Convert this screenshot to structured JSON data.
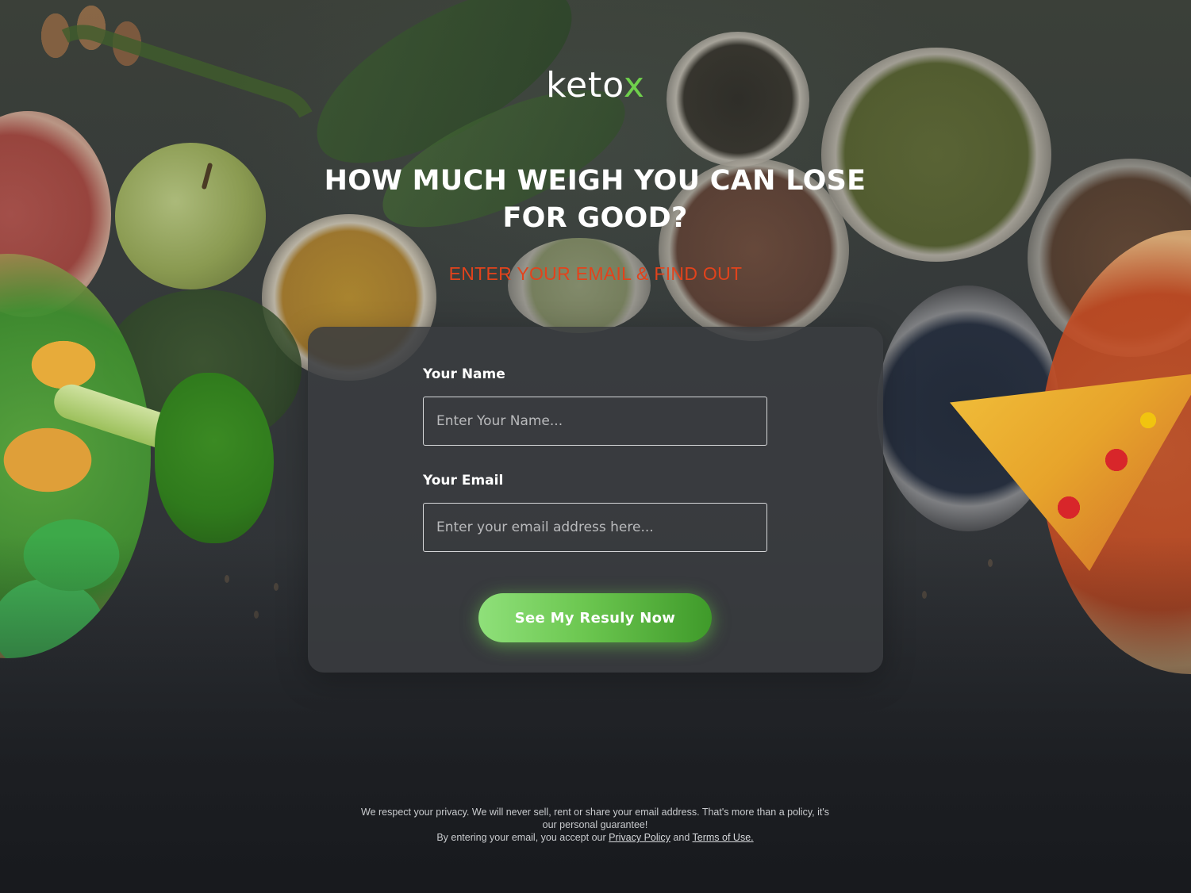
{
  "brand": {
    "logo_main": "keto",
    "logo_accent": "x",
    "accent_color": "#6fd04c"
  },
  "hero": {
    "headline": "HOW MUCH WEIGH YOU CAN LOSE FOR GOOD?",
    "subheadline": "ENTER YOUR EMAIL & FIND OUT",
    "subheadline_color": "#e2431c"
  },
  "form": {
    "name_label": "Your Name",
    "name_placeholder": "Enter Your Name...",
    "name_value": "",
    "email_label": "Your Email",
    "email_placeholder": "Enter your email address here...",
    "email_value": "",
    "submit_label": "See My Resuly Now",
    "submit_color": "#6cc750"
  },
  "footer": {
    "privacy_text": "We respect your privacy. We will never sell, rent or share your email address. That's more than a policy, it's our personal guarantee!",
    "consent_prefix": "By entering your email, you accept our",
    "privacy_link": "Privacy Policy",
    "and_text": "and",
    "terms_link": "Terms of Use."
  },
  "background_icons": [
    "almonds",
    "green-pepper",
    "grapefruit",
    "apple",
    "spinach-leaves",
    "turmeric-bowl",
    "tea-bowl",
    "mung-bean-bowl",
    "rice-bowl",
    "blueberry-bowl",
    "salad-bowl",
    "broccoli",
    "pizza-slice"
  ]
}
